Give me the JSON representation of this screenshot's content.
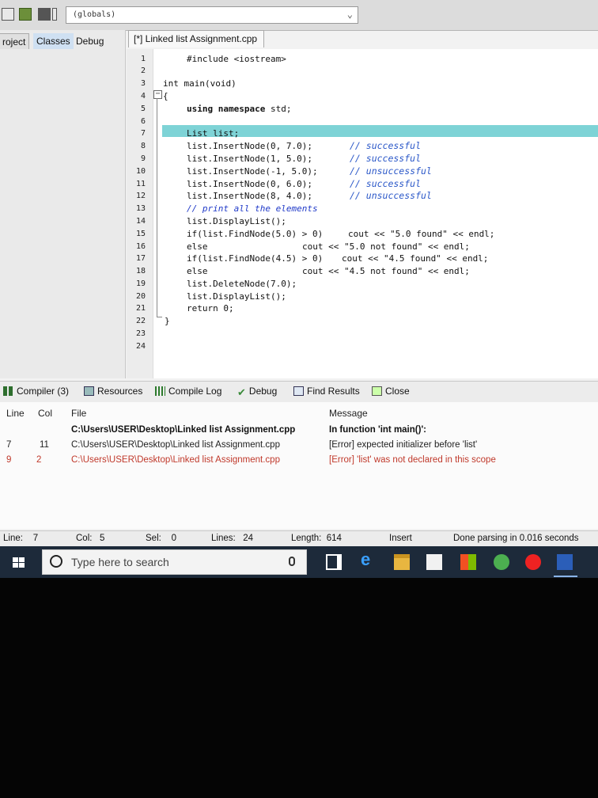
{
  "toolbar": {
    "scope_selector": "(globals)"
  },
  "left_panel": {
    "tabs": [
      "roject",
      "Classes",
      "Debug"
    ]
  },
  "editor": {
    "file_tab": "[*] Linked list Assignment.cpp",
    "line_numbers": [
      "1",
      "2",
      "3",
      "4",
      "5",
      "6",
      "7",
      "8",
      "9",
      "10",
      "11",
      "12",
      "13",
      "14",
      "15",
      "16",
      "17",
      "18",
      "19",
      "20",
      "21",
      "22",
      "23",
      "24"
    ],
    "current_line": 7,
    "code": {
      "l2": "#include <iostream>",
      "l4": "int main(void)",
      "l5": "{",
      "l6_kw": "using namespace",
      "l6_rest": " std;",
      "l8": "List list;",
      "l9": "list.InsertNode(0, 7.0);",
      "l10": "list.InsertNode(1, 5.0);",
      "l11": "list.InsertNode(-1, 5.0);",
      "l12": "list.InsertNode(0, 6.0);",
      "l13": "list.InsertNode(8, 4.0);",
      "l14": "// print all the elements",
      "l15": "list.DisplayList();",
      "l16a": "if(list.FindNode(5.0) > 0)",
      "l16b": "cout << \"5.0 found\" << endl;",
      "l17a": "else",
      "l17b": "cout << \"5.0 not found\" << endl;",
      "l18a": "if(list.FindNode(4.5) > 0)",
      "l18b": "cout << \"4.5 found\" << endl;",
      "l19a": "else",
      "l19b": "cout << \"4.5 not found\" << endl;",
      "l20": "list.DeleteNode(7.0);",
      "l21": "list.DisplayList();",
      "l22": "return 0;",
      "l23": "}"
    },
    "comments": [
      "// successful",
      "// successful",
      "// unsuccessful",
      "// successful",
      "// unsuccessful"
    ]
  },
  "bottom_tabs": {
    "compiler": "Compiler (3)",
    "resources": "Resources",
    "compile_log": "Compile Log",
    "debug": "Debug",
    "find_results": "Find Results",
    "close": "Close"
  },
  "results": {
    "headers": {
      "line": "Line",
      "col": "Col",
      "file": "File",
      "message": "Message"
    },
    "rows": [
      {
        "line": "",
        "col": "",
        "file": "C:\\Users\\USER\\Desktop\\Linked list Assignment.cpp",
        "message": "In function 'int main()':"
      },
      {
        "line": "7",
        "col": "11",
        "file": "C:\\Users\\USER\\Desktop\\Linked list Assignment.cpp",
        "message": "[Error] expected initializer before 'list'"
      },
      {
        "line": "9",
        "col": "2",
        "file": "C:\\Users\\USER\\Desktop\\Linked list Assignment.cpp",
        "message": "[Error] 'list' was not declared in this scope"
      }
    ]
  },
  "status": {
    "line_label": "Line:",
    "line_value": "7",
    "col_label": "Col:",
    "col_value": "5",
    "sel_label": "Sel:",
    "sel_value": "0",
    "lines_label": "Lines:",
    "lines_value": "24",
    "length_label": "Length:",
    "length_value": "614",
    "mode": "Insert",
    "message": "Done parsing in 0.016 seconds"
  },
  "taskbar": {
    "search_placeholder": "Type here to search"
  }
}
